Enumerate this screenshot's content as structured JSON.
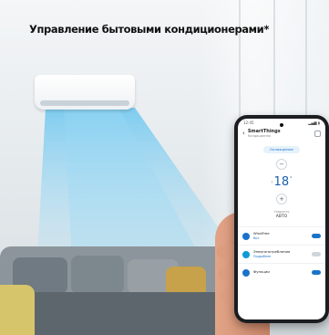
{
  "headline": "Управление бытовыми кондиционерами*",
  "bottom_caption": "",
  "phone": {
    "status_time": "12:45",
    "status_icons": "▂▄▆ ▮",
    "app_title": "SmartThings",
    "app_subtitle": "Кондиционер",
    "mode_label": "Охлаждение",
    "minus_label": "−",
    "plus_label": "+",
    "temp_label": "Т",
    "temperature": "18",
    "temp_unit": "°",
    "fan_label": "Скорость",
    "fan_value": "АВТО",
    "rows": [
      {
        "title": "WindFree",
        "sub": "Вкл"
      },
      {
        "title": "Энергопотребление",
        "sub": "Подробнее"
      },
      {
        "title": "Функции",
        "sub": ""
      }
    ]
  },
  "colors": {
    "accent": "#1a73c9",
    "airflow": "#7fd0f2"
  }
}
